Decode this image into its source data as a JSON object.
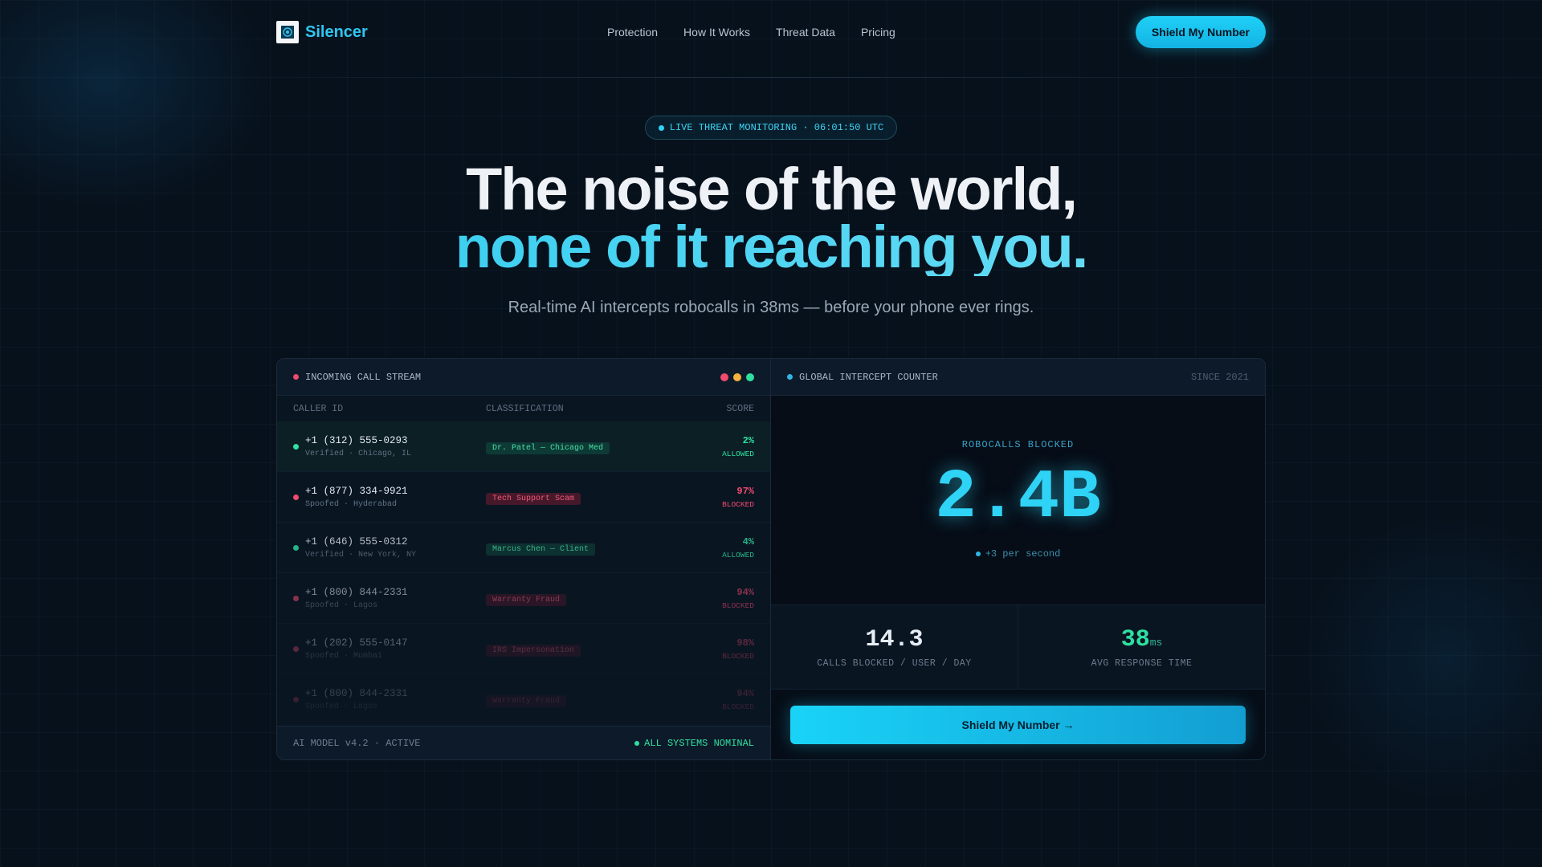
{
  "nav": {
    "brand": "Silencer",
    "links": [
      "Protection",
      "How It Works",
      "Threat Data",
      "Pricing"
    ],
    "cta": "Shield My Number"
  },
  "hero": {
    "badge": "LIVE THREAT MONITORING · 06:01:50 UTC",
    "title_line1": "The noise of the world,",
    "title_line2": "none of it reaching you.",
    "subtitle": "Real-time AI intercepts robocalls in 38ms — before your phone ever rings."
  },
  "stream": {
    "title": "INCOMING CALL STREAM",
    "columns": [
      "CALLER ID",
      "CLASSIFICATION",
      "SCORE"
    ],
    "rows": [
      {
        "number": "+1 (312) 555-0293",
        "detail": "Verified · Chicago, IL",
        "classification": "Dr. Patel — Chicago Med",
        "score": "2%",
        "status": "ALLOWED"
      },
      {
        "number": "+1 (877) 334-9921",
        "detail": "Spoofed · Hyderabad",
        "classification": "Tech Support Scam",
        "score": "97%",
        "status": "BLOCKED"
      },
      {
        "number": "+1 (646) 555-0312",
        "detail": "Verified · New York, NY",
        "classification": "Marcus Chen — Client",
        "score": "4%",
        "status": "ALLOWED"
      },
      {
        "number": "+1 (800) 844-2331",
        "detail": "Spoofed · Lagos",
        "classification": "Warranty Fraud",
        "score": "94%",
        "status": "BLOCKED"
      },
      {
        "number": "+1 (202) 555-0147",
        "detail": "Spoofed · Mumbai",
        "classification": "IRS Impersonation",
        "score": "98%",
        "status": "BLOCKED"
      },
      {
        "number": "+1 (800) 844-2331",
        "detail": "Spoofed · Lagos",
        "classification": "Warranty Fraud",
        "score": "94%",
        "status": "BLOCKED"
      }
    ],
    "footer_left": "AI MODEL v4.2 · ACTIVE",
    "footer_right": "ALL SYSTEMS NOMINAL"
  },
  "counter": {
    "title": "GLOBAL INTERCEPT COUNTER",
    "since": "SINCE 2021",
    "label": "ROBOCALLS BLOCKED",
    "value": "2.4B",
    "rate": "+3 per second",
    "stats": [
      {
        "value": "14.3",
        "unit": "",
        "label": "CALLS BLOCKED / USER / DAY"
      },
      {
        "value": "38",
        "unit": "ms",
        "label": "AVG RESPONSE TIME"
      }
    ],
    "cta": "Shield My Number →"
  },
  "colors": {
    "accent": "#22c8ee",
    "allowed": "#2fe0a0",
    "blocked": "#f04a6e",
    "background": "#07111c"
  }
}
